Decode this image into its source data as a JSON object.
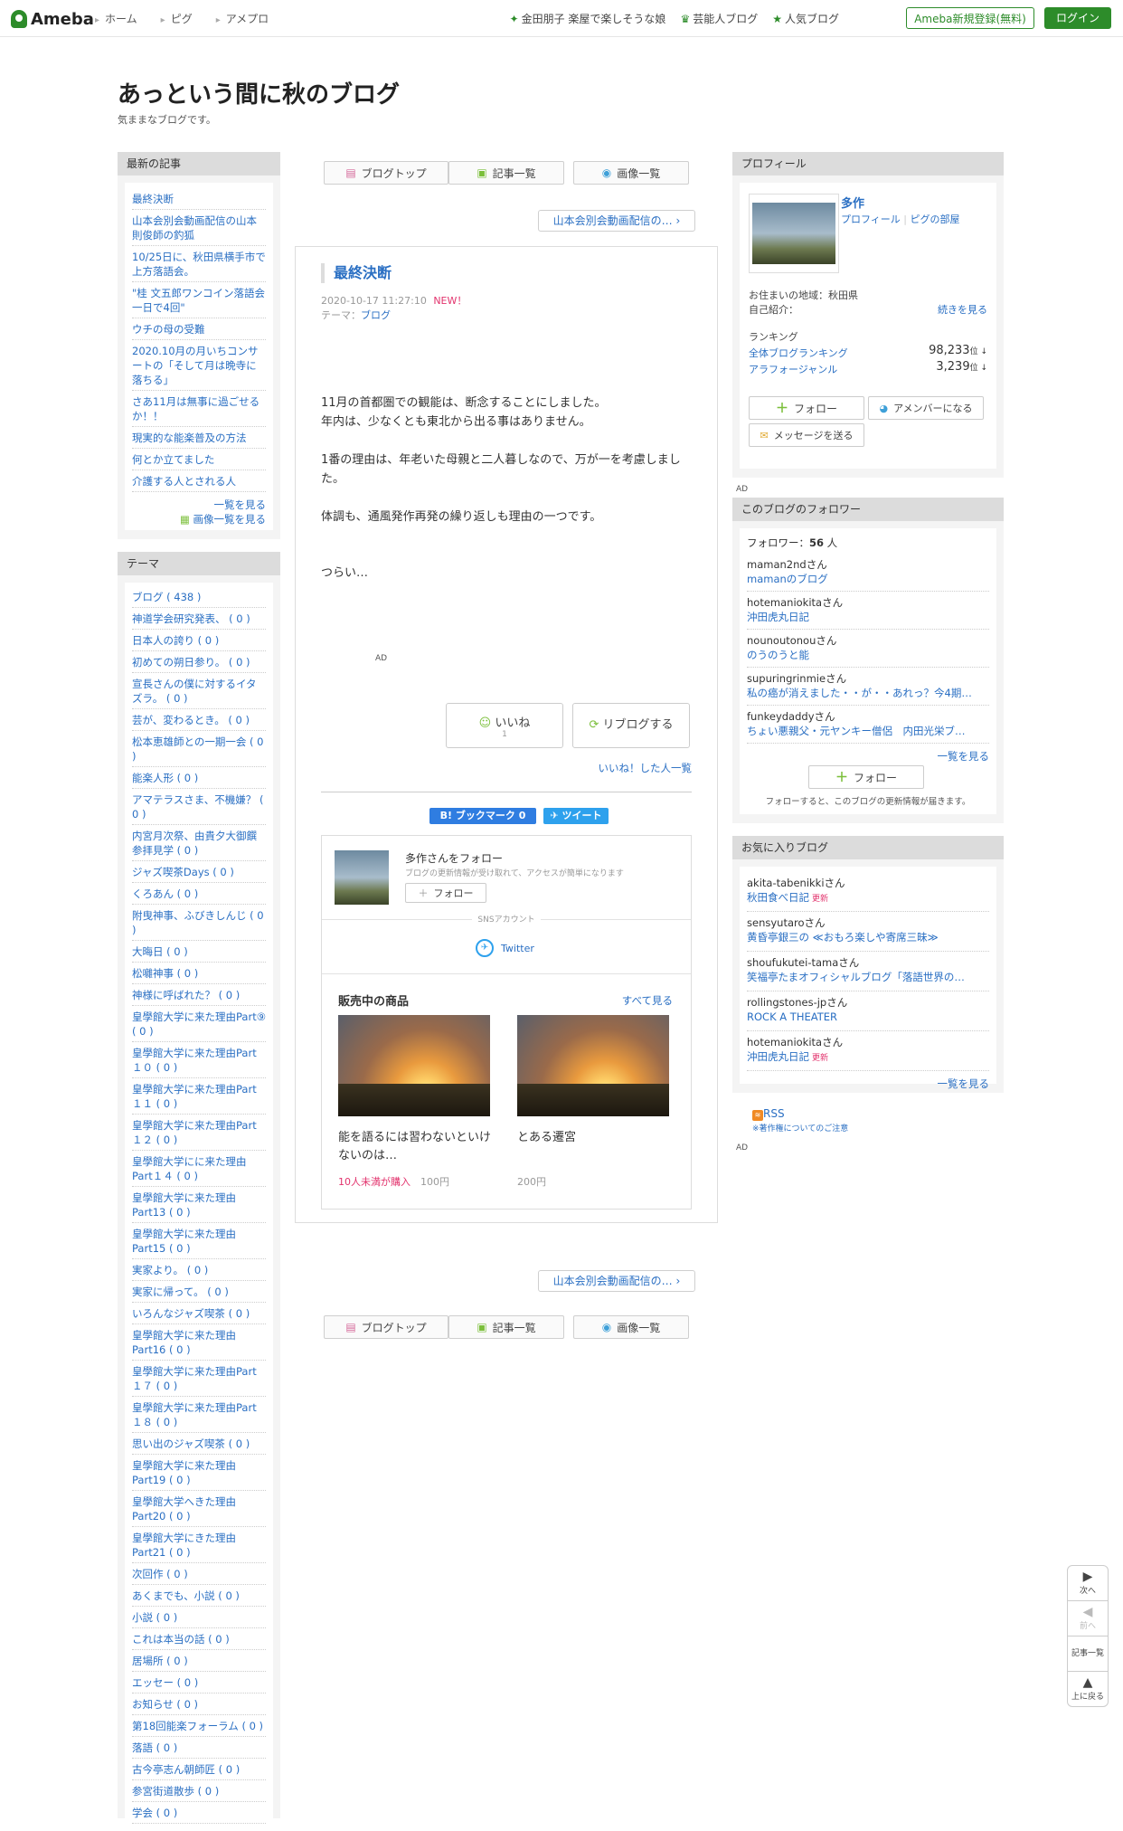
{
  "header": {
    "logo": "Ameba",
    "crumbs": [
      "ホーム",
      "ピグ",
      "アメプロ"
    ],
    "links": [
      "金田朋子 楽屋で楽しそうな娘",
      "芸能人ブログ",
      "人気ブログ"
    ],
    "register": "Ameba新規登録(無料)",
    "login": "ログイン"
  },
  "blog": {
    "title": "あっという間に秋のブログ",
    "description": "気ままなブログです。"
  },
  "recent": {
    "heading": "最新の記事",
    "items": [
      "最終決断",
      "山本会別会動画配信の山本則俊師の釣狐",
      "10/25日に、秋田県横手市で上方落語会。",
      "\"桂 文五郎ワンコイン落語会 一日で4回\"",
      "ウチの母の受難",
      "2020.10月の月いちコンサートの「そして月は晩寺に落ちる」",
      "さあ11月は無事に過ごせるか！！",
      "現実的な能楽普及の方法",
      "何とか立てました",
      "介護する人とされる人"
    ],
    "more": "一覧を見る",
    "more_images": "画像一覧を見る"
  },
  "themes": {
    "heading": "テーマ",
    "items": [
      "ブログ ( 438 )",
      "神道学会研究発表、 ( 0 )",
      "日本人の誇り ( 0 )",
      "初めての朔日参り。 ( 0 )",
      "宣長さんの僕に対するイタズラ。 ( 0 )",
      "芸が、変わるとき。 ( 0 )",
      "松本恵雄師との一期一会 ( 0 )",
      "能楽人形 ( 0 )",
      "アマテラスさま、不機嫌？ ( 0 )",
      "内宮月次祭、由貴夕大御饌参拝見学 ( 0 )",
      "ジャズ喫茶Days ( 0 )",
      "くろあん ( 0 )",
      "附曳神事、ふびきしんじ ( 0 )",
      "大晦日 ( 0 )",
      "松囃神事 ( 0 )",
      "神様に呼ばれた？ ( 0 )",
      "皇學館大学に来た理由Part⑨ ( 0 )",
      "皇學館大学に来た理由Part１０ ( 0 )",
      "皇學館大学に来た理由Part１１ ( 0 )",
      "皇學館大学に来た理由Part１２ ( 0 )",
      "皇學館大学にに来た理由Part１４ ( 0 )",
      "皇學館大学に来た理由Part13 ( 0 )",
      "皇學館大学に来た理由Part15 ( 0 )",
      "実家より。 ( 0 )",
      "実家に帰って。 ( 0 )",
      "いろんなジャズ喫茶 ( 0 )",
      "皇學館大学に来た理由Part16 ( 0 )",
      "皇學館大学に来た理由Part１７ ( 0 )",
      "皇學館大学に来た理由Part１８ ( 0 )",
      "思い出のジャズ喫茶 ( 0 )",
      "皇學館大学に来た理由Part19 ( 0 )",
      "皇學館大学へきた理由Part20 ( 0 )",
      "皇學館大学にきた理由Part21 ( 0 )",
      "次回作 ( 0 )",
      "あくまでも、小説 ( 0 )",
      "小説 ( 0 )",
      "これは本当の話 ( 0 )",
      "居場所 ( 0 )",
      "エッセー ( 0 )",
      "お知らせ ( 0 )",
      "第18回能楽フォーラム ( 0 )",
      "落語 ( 0 )",
      "古今亭志ん朝師匠 ( 0 )",
      "参宮街道散歩 ( 0 )",
      "学会 ( 0 )"
    ]
  },
  "nav": {
    "top": "ブログトップ",
    "list": "記事一覧",
    "images": "画像一覧",
    "prev_article": "山本会別会動画配信の…"
  },
  "article": {
    "title": "最終決断",
    "datetime": "2020-10-17 11:27:10",
    "new_label": "NEW！",
    "theme_prefix": "テーマ：",
    "theme": "ブログ",
    "paragraphs": [
      "11月の首都圏での観能は、断念することにしました。\n年内は、少なくとも東北から出る事はありません。",
      "1番の理由は、年老いた母親と二人暮しなので、万が一を考慮しました。",
      "体調も、通風発作再発の繰り返しも理由の一つです。",
      "つらい…"
    ],
    "ad": "AD",
    "like": "いいね",
    "like_count": "1",
    "reblog": "リブログする",
    "liked_list": "いいね！した人一覧",
    "hatena": "B! ブックマーク",
    "hatena_count": "0",
    "tweet": "ツイート"
  },
  "follow_card": {
    "title": "多作さんをフォロー",
    "sub": "ブログの更新情報が受け取れて、アクセスが簡単になります",
    "follow": "フォロー",
    "sns_label": "SNSアカウント",
    "twitter": "Twitter",
    "products_heading": "販売中の商品",
    "see_all": "すべて見る",
    "products": [
      {
        "name": "能を語るには習わないといけないのは…",
        "buyers": "10人未満が購入",
        "price": "100円"
      },
      {
        "name": "とある遷宮",
        "buyers": "",
        "price": "200円"
      }
    ]
  },
  "profile": {
    "heading": "プロフィール",
    "name": "多作",
    "links": [
      "プロフィール",
      "ピグの部屋"
    ],
    "residence": "お住まいの地域：秋田県",
    "intro": "自己紹介：",
    "read_more": "続きを見る",
    "ranking_label": "ランキング",
    "rank1_name": "全体ブログランキング",
    "rank1_value": "98,233",
    "rank2_name": "アラフォージャンル",
    "rank2_value": "3,239",
    "rank_suffix": "位 ↓",
    "follow": "フォロー",
    "amember": "アメンバーになる",
    "message": "メッセージを送る"
  },
  "followers": {
    "heading": "このブログのフォロワー",
    "count_label": "フォロワー：",
    "count": "56",
    "count_unit": "人",
    "items": [
      {
        "user": "maman2nd",
        "blog": "mamanのブログ"
      },
      {
        "user": "hotemaniokita",
        "blog": "沖田虎丸日記"
      },
      {
        "user": "nounoutonou",
        "blog": "のうのうと能"
      },
      {
        "user": "supuringrinmie",
        "blog": "私の癌が消えました・・が・・あれっ？今4期…"
      },
      {
        "user": "funkeydaddy",
        "blog": "ちょい悪親父・元ヤンキー僧侶　内田光栄ブ…"
      }
    ],
    "san": "さん",
    "more": "一覧を見る",
    "follow": "フォロー",
    "note": "フォローすると、このブログの更新情報が届きます。"
  },
  "favorites": {
    "heading": "お気に入りブログ",
    "items": [
      {
        "user": "akita-tabenikki",
        "blog": "秋田食べ日記",
        "updated": "更新"
      },
      {
        "user": "sensyutaro",
        "blog": "黄昏亭銀三の ≪おもろ楽しや寄席三昧≫",
        "updated": ""
      },
      {
        "user": "shoufukutei-tama",
        "blog": "笑福亭たまオフィシャルブログ「落語世界の…",
        "updated": ""
      },
      {
        "user": "rollingstones-jp",
        "blog": "ROCK A THEATER",
        "updated": ""
      },
      {
        "user": "hotemaniokita",
        "blog": "沖田虎丸日記",
        "updated": "更新"
      }
    ],
    "more": "一覧を見る"
  },
  "rss": {
    "label": "RSS",
    "note": "※著作権についてのご注意"
  },
  "page_nav": {
    "next": "次へ",
    "prev": "前へ",
    "list": "記事一覧",
    "top": "上に戻る"
  },
  "colors": {
    "brand_green": "#2d8c2a",
    "link_blue": "#2a6fc3",
    "accent_pink": "#e2336d"
  }
}
